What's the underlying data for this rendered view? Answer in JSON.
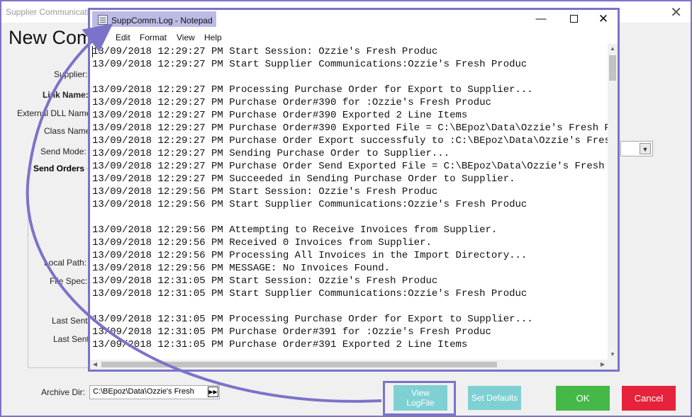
{
  "outer_window": {
    "title": "Supplier Communicati",
    "heading": "New Com",
    "labels": {
      "supplier": "Supplier:",
      "link_name": "Link Name:",
      "external_dll_names": "External DLL Names",
      "class_names": "Class Names",
      "send_mode": "Send Mode:",
      "send_orders": "Send Orders",
      "local_path": "Local Path:",
      "file_spec": "File Spec:",
      "last_sent_1": "Last Sent I",
      "last_sent_2": "Last Sent"
    },
    "archive_dir": {
      "label": "Archive Dir:",
      "value": "C:\\BEpoz\\Data\\Ozzie's Fresh"
    },
    "buttons": {
      "view_logfile_line1": "View",
      "view_logfile_line2": "LogFile",
      "set_defaults": "Set Defaults",
      "ok": "OK",
      "cancel": "Cancel"
    },
    "colors": {
      "accent_outline": "#7b73c9",
      "teal": "#7fd0d3",
      "ok_green": "#46b848",
      "cancel_red": "#e6213b"
    }
  },
  "notepad": {
    "title": "SuppComm.Log - Notepad",
    "menu": [
      "File",
      "Edit",
      "Format",
      "View",
      "Help"
    ],
    "lines": [
      "13/09/2018 12:29:27 PM Start Session: Ozzie's Fresh Produc",
      "13/09/2018 12:29:27 PM Start Supplier Communications:Ozzie's Fresh Produc",
      "",
      "13/09/2018 12:29:27 PM Processing Purchase Order for Export to Supplier...",
      "13/09/2018 12:29:27 PM Purchase Order#390 for :Ozzie's Fresh Produc",
      "13/09/2018 12:29:27 PM Purchase Order#390 Exported 2 Line Items",
      "13/09/2018 12:29:27 PM Purchase Order#390 Exported File = C:\\BEpoz\\Data\\Ozzie's Fresh Produ",
      "13/09/2018 12:29:27 PM Purchase Order Export successfuly to :C:\\BEpoz\\Data\\Ozzie's Fresh Pr",
      "13/09/2018 12:29:27 PM Sending Purchase Order to Supplier...",
      "13/09/2018 12:29:27 PM Purchase Order Send Exported File = C:\\BEpoz\\Data\\Ozzie's Fresh Proc",
      "13/09/2018 12:29:27 PM Succeeded in Sending Purchase Order to Supplier.",
      "13/09/2018 12:29:56 PM Start Session: Ozzie's Fresh Produc",
      "13/09/2018 12:29:56 PM Start Supplier Communications:Ozzie's Fresh Produc",
      "",
      "13/09/2018 12:29:56 PM Attempting to Receive Invoices from Supplier.",
      "13/09/2018 12:29:56 PM Received 0 Invoices from Supplier.",
      "13/09/2018 12:29:56 PM Processing All Invoices in the Import Directory...",
      "13/09/2018 12:29:56 PM MESSAGE: No Invoices Found.",
      "13/09/2018 12:31:05 PM Start Session: Ozzie's Fresh Produc",
      "13/09/2018 12:31:05 PM Start Supplier Communications:Ozzie's Fresh Produc",
      "",
      "13/09/2018 12:31:05 PM Processing Purchase Order for Export to Supplier...",
      "13/09/2018 12:31:05 PM Purchase Order#391 for :Ozzie's Fresh Produc",
      "13/09/2018 12:31:05 PM Purchase Order#391 Exported 2 Line Items"
    ]
  }
}
